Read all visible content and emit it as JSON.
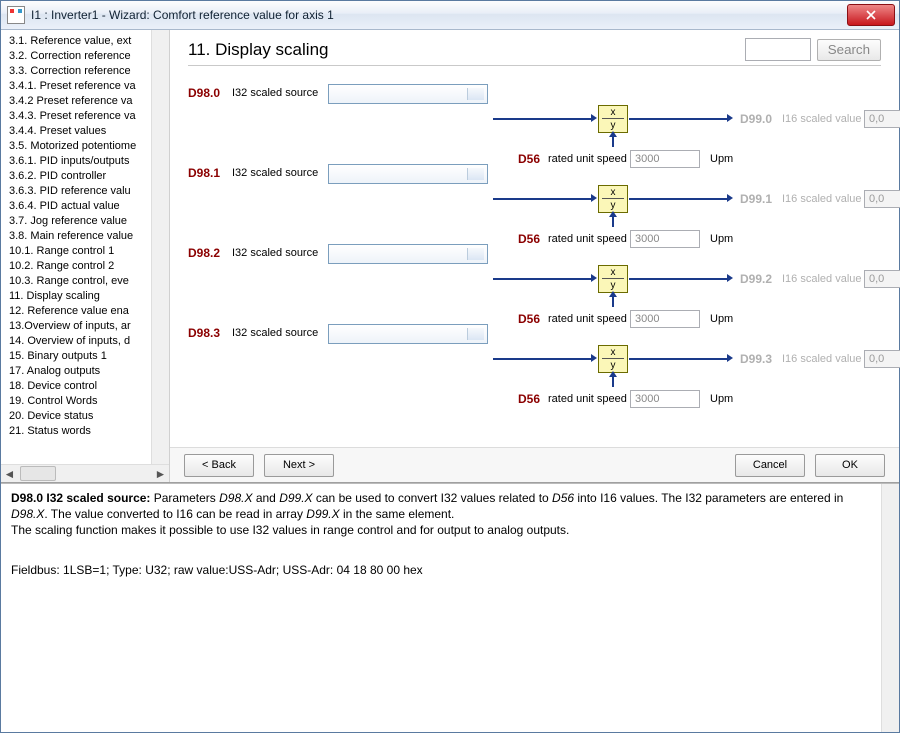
{
  "window": {
    "title": "I1 : Inverter1 - Wizard: Comfort reference value for axis 1"
  },
  "sidebar": {
    "items": [
      "3.1. Reference value, ext",
      "3.2. Correction reference",
      "3.3. Correction reference",
      "3.4.1. Preset reference va",
      "3.4.2 Preset reference va",
      "3.4.3. Preset reference va",
      "3.4.4. Preset values",
      "3.5. Motorized potentiome",
      "3.6.1. PID inputs/outputs",
      "3.6.2. PID controller",
      "3.6.3. PID reference valu",
      "3.6.4. PID actual value",
      "3.7. Jog reference value",
      "3.8. Main reference value",
      "10.1. Range control 1",
      "10.2. Range control 2",
      "10.3. Range control, eve",
      "11. Display scaling",
      "12. Reference value ena",
      "13.Overview of inputs, ar",
      "14. Overview of inputs, d",
      "15. Binary outputs 1",
      "17. Analog outputs",
      "18. Device control",
      "19. Control Words",
      "20. Device status",
      "21. Status words"
    ]
  },
  "header": {
    "title": "11. Display scaling",
    "search_btn": "Search"
  },
  "rows": [
    {
      "param": "D98.0",
      "src_label": "I32 scaled source",
      "out_param": "D99.0",
      "out_label": "I16 scaled value",
      "out_value": "0,0",
      "out_unit": "%",
      "rate_param": "D56",
      "rate_label": "rated unit speed",
      "rate_value": "3000",
      "rate_unit": "Upm"
    },
    {
      "param": "D98.1",
      "src_label": "I32 scaled source",
      "out_param": "D99.1",
      "out_label": "I16 scaled value",
      "out_value": "0,0",
      "out_unit": "%",
      "rate_param": "D56",
      "rate_label": "rated unit speed",
      "rate_value": "3000",
      "rate_unit": "Upm"
    },
    {
      "param": "D98.2",
      "src_label": "I32 scaled source",
      "out_param": "D99.2",
      "out_label": "I16 scaled value",
      "out_value": "0,0",
      "out_unit": "%",
      "rate_param": "D56",
      "rate_label": "rated unit speed",
      "rate_value": "3000",
      "rate_unit": "Upm"
    },
    {
      "param": "D98.3",
      "src_label": "I32 scaled source",
      "out_param": "D99.3",
      "out_label": "I16 scaled value",
      "out_value": "0,0",
      "out_unit": "%",
      "rate_param": "D56",
      "rate_label": "rated unit speed",
      "rate_value": "3000",
      "rate_unit": "Upm"
    }
  ],
  "footer": {
    "back": "< Back",
    "next": "Next >",
    "cancel": "Cancel",
    "ok": "OK"
  },
  "help": {
    "h1_bold": "D98.0  I32 scaled source:",
    "h1_rest_a": " Parameters ",
    "h1_i1": "D98.X",
    "h1_rest_b": " and ",
    "h1_i2": "D99.X",
    "h1_rest_c": " can be used to convert I32 values related to ",
    "h1_i3": "D56",
    "h1_rest_d": " into I16 values. The I32 parameters are entered in ",
    "h1_i4": "D98.X",
    "h1_rest_e": ". The value converted to I16 can be read in array ",
    "h1_i5": "D99.X",
    "h1_rest_f": " in the same element.",
    "p2": "The scaling function makes it possible to use I32 values in range control and for output to analog outputs.",
    "p3": "Fieldbus: 1LSB=1; Type: U32; raw value:USS-Adr; USS-Adr: 04 18 80 00 hex"
  }
}
